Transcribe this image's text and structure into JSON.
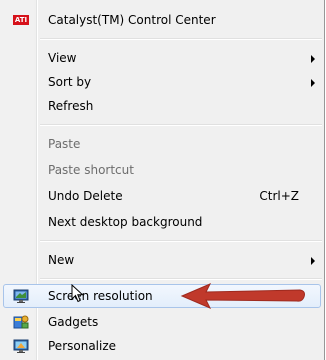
{
  "menu": {
    "items": [
      {
        "label": "Catalyst(TM) Control Center",
        "icon": "ati-logo-icon"
      },
      {
        "label": "View",
        "submenu": true
      },
      {
        "label": "Sort by",
        "submenu": true
      },
      {
        "label": "Refresh"
      },
      {
        "label": "Paste",
        "disabled": true
      },
      {
        "label": "Paste shortcut",
        "disabled": true
      },
      {
        "label": "Undo Delete",
        "shortcut": "Ctrl+Z"
      },
      {
        "label": "Next desktop background"
      },
      {
        "label": "New",
        "submenu": true
      },
      {
        "label": "Screen resolution",
        "icon": "screen-resolution-icon",
        "highlighted": true
      },
      {
        "label": "Gadgets",
        "icon": "gadgets-icon"
      },
      {
        "label": "Personalize",
        "icon": "personalize-icon"
      }
    ]
  },
  "colors": {
    "menu_background": "#f0f0f0",
    "highlight_border": "#a8c4ea",
    "annotation_arrow": "#c0392b",
    "disabled_text": "#6d6d6d"
  }
}
